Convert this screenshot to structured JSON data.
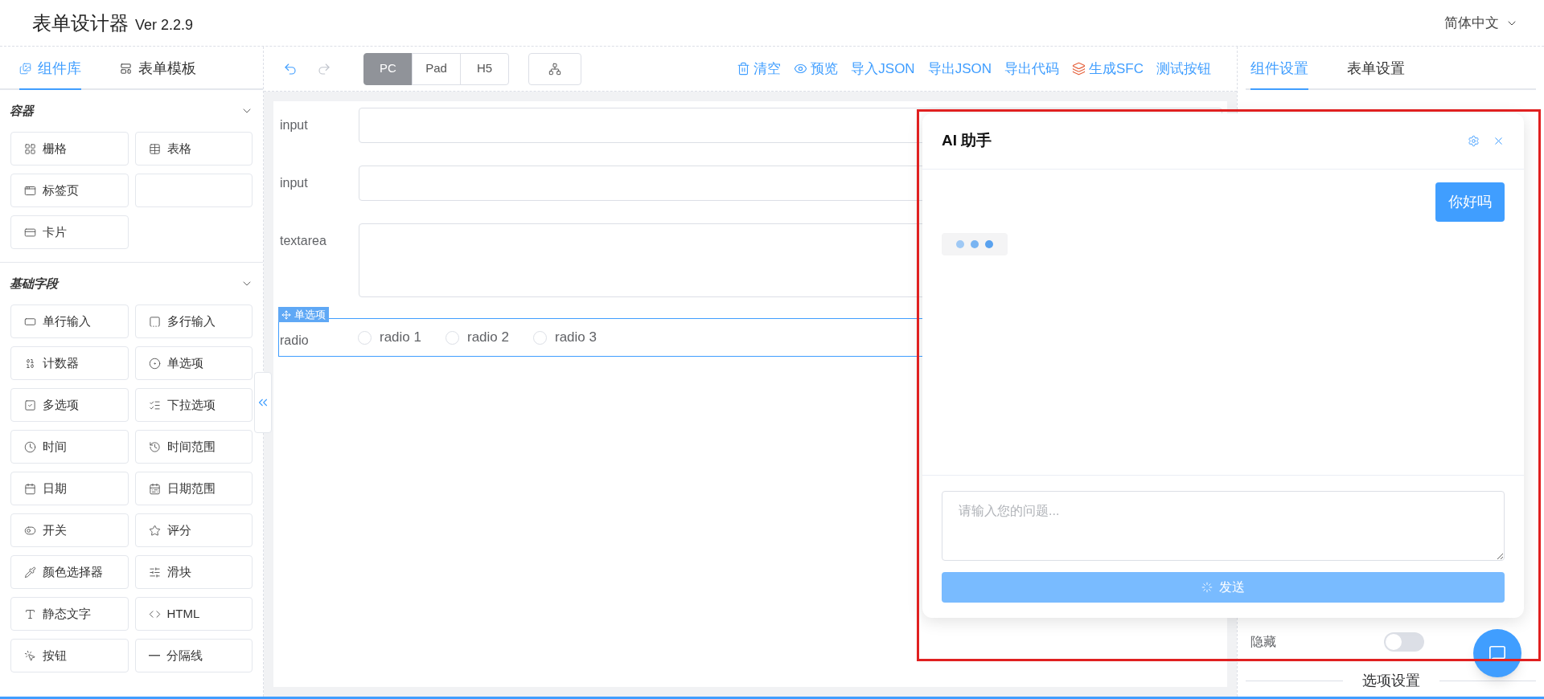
{
  "header": {
    "title": "表单设计器",
    "version": "Ver 2.2.9",
    "language": "简体中文"
  },
  "left_panel": {
    "tabs": [
      {
        "label": "组件库",
        "selected": true
      },
      {
        "label": "表单模板",
        "selected": false
      }
    ],
    "sections": [
      {
        "title": "容器",
        "expanded": true,
        "items": [
          {
            "kind": "widget",
            "label": "栅格"
          },
          {
            "kind": "widget",
            "label": "表格"
          },
          {
            "kind": "widget",
            "label": "标签页"
          },
          {
            "kind": "blank"
          },
          {
            "kind": "widget",
            "label": "卡片"
          }
        ]
      },
      {
        "title": "基础字段",
        "expanded": true,
        "items": [
          {
            "kind": "widget",
            "label": "单行输入"
          },
          {
            "kind": "widget",
            "label": "多行输入"
          },
          {
            "kind": "widget",
            "label": "计数器"
          },
          {
            "kind": "widget",
            "label": "单选项"
          },
          {
            "kind": "widget",
            "label": "多选项"
          },
          {
            "kind": "widget",
            "label": "下拉选项"
          },
          {
            "kind": "widget",
            "label": "时间"
          },
          {
            "kind": "widget",
            "label": "时间范围"
          },
          {
            "kind": "widget",
            "label": "日期"
          },
          {
            "kind": "widget",
            "label": "日期范围"
          },
          {
            "kind": "widget",
            "label": "开关"
          },
          {
            "kind": "widget",
            "label": "评分"
          },
          {
            "kind": "widget",
            "label": "颜色选择器"
          },
          {
            "kind": "widget",
            "label": "滑块"
          },
          {
            "kind": "widget",
            "label": "静态文字"
          },
          {
            "kind": "widget",
            "label": "HTML"
          },
          {
            "kind": "widget",
            "label": "按钮"
          },
          {
            "kind": "widget",
            "label": "分隔线"
          }
        ]
      }
    ]
  },
  "toolbar": {
    "devices": [
      {
        "label": "PC",
        "selected": true
      },
      {
        "label": "Pad",
        "selected": false
      },
      {
        "label": "H5",
        "selected": false
      }
    ],
    "actions": [
      {
        "label": "清空"
      },
      {
        "label": "预览"
      },
      {
        "label": "导入JSON"
      },
      {
        "label": "导出JSON"
      },
      {
        "label": "导出代码"
      },
      {
        "label": "生成SFC"
      },
      {
        "label": "测试按钮"
      }
    ]
  },
  "form": {
    "fields": [
      {
        "kind": "input",
        "label": "input"
      },
      {
        "kind": "input",
        "label": "input"
      },
      {
        "kind": "textarea",
        "label": "textarea"
      },
      {
        "kind": "radio",
        "label": "radio",
        "badge": "单选项",
        "selected": true,
        "options": [
          {
            "label": "radio 1",
            "selected": false
          },
          {
            "label": "radio 2",
            "selected": false
          },
          {
            "label": "radio 3",
            "selected": false
          }
        ]
      }
    ]
  },
  "right_panel": {
    "tabs": [
      {
        "label": "组件设置",
        "selected": true
      },
      {
        "label": "表单设置",
        "selected": false
      }
    ],
    "switches": [
      {
        "label": "隐藏",
        "on": false
      }
    ],
    "section_title": "选项设置"
  },
  "ai_dialog": {
    "title": "AI 助手",
    "highlighted": true,
    "messages": [
      {
        "kind": "user",
        "text": "你好吗"
      },
      {
        "kind": "typing"
      }
    ],
    "input": {
      "placeholder": "请输入您的问题..."
    },
    "send": {
      "label": "发送",
      "loading": true
    }
  }
}
